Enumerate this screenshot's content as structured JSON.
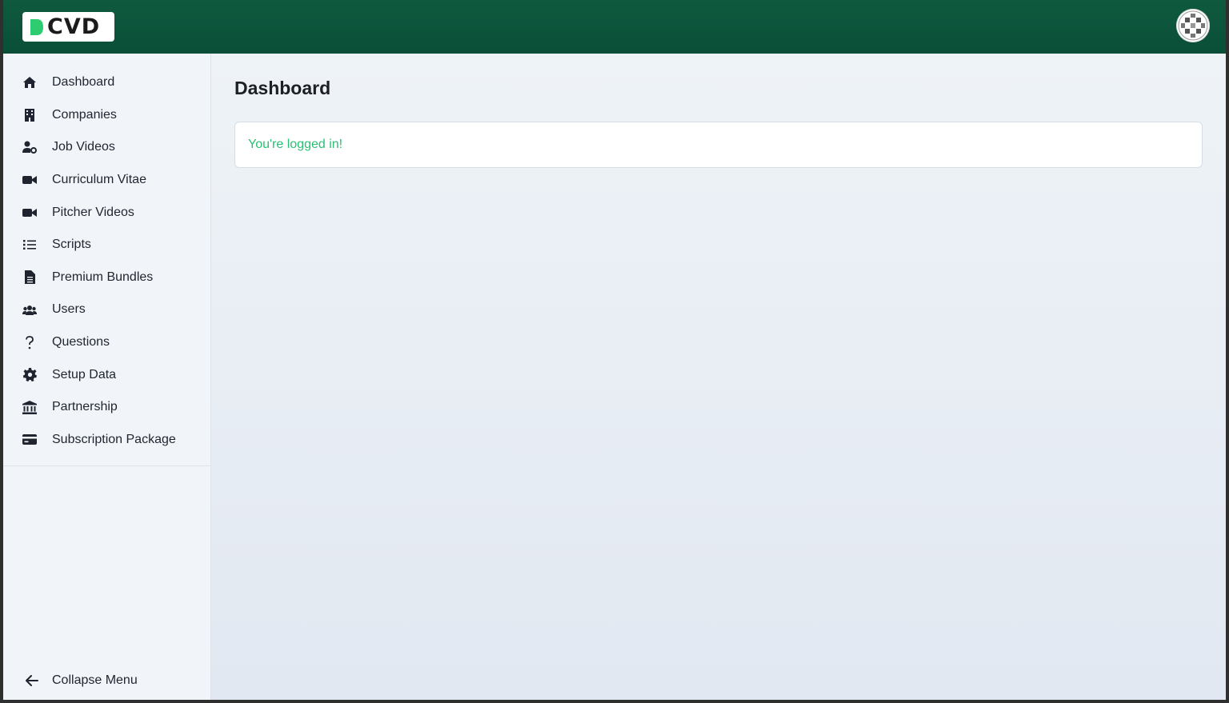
{
  "brand": {
    "logo_text": "CVD",
    "accent": "#0a4e37",
    "logo_mark_color": "#2ecc71"
  },
  "header": {
    "avatar_icon": "user-avatar-icon"
  },
  "sidebar": {
    "items": [
      {
        "label": "Dashboard",
        "icon": "home-icon"
      },
      {
        "label": "Companies",
        "icon": "building-icon"
      },
      {
        "label": "Job Videos",
        "icon": "user-gear-icon"
      },
      {
        "label": "Curriculum Vitae",
        "icon": "video-camera-icon"
      },
      {
        "label": "Pitcher Videos",
        "icon": "video-camera-icon"
      },
      {
        "label": "Scripts",
        "icon": "list-icon"
      },
      {
        "label": "Premium Bundles",
        "icon": "file-icon"
      },
      {
        "label": "Users",
        "icon": "users-icon"
      },
      {
        "label": "Questions",
        "icon": "question-icon"
      },
      {
        "label": "Setup Data",
        "icon": "gear-icon"
      },
      {
        "label": "Partnership",
        "icon": "bank-icon"
      },
      {
        "label": "Subscription Package",
        "icon": "credit-card-icon"
      }
    ],
    "collapse_label": "Collapse Menu"
  },
  "main": {
    "title": "Dashboard",
    "status_message": "You're logged in!",
    "status_color": "#2bbf73"
  }
}
